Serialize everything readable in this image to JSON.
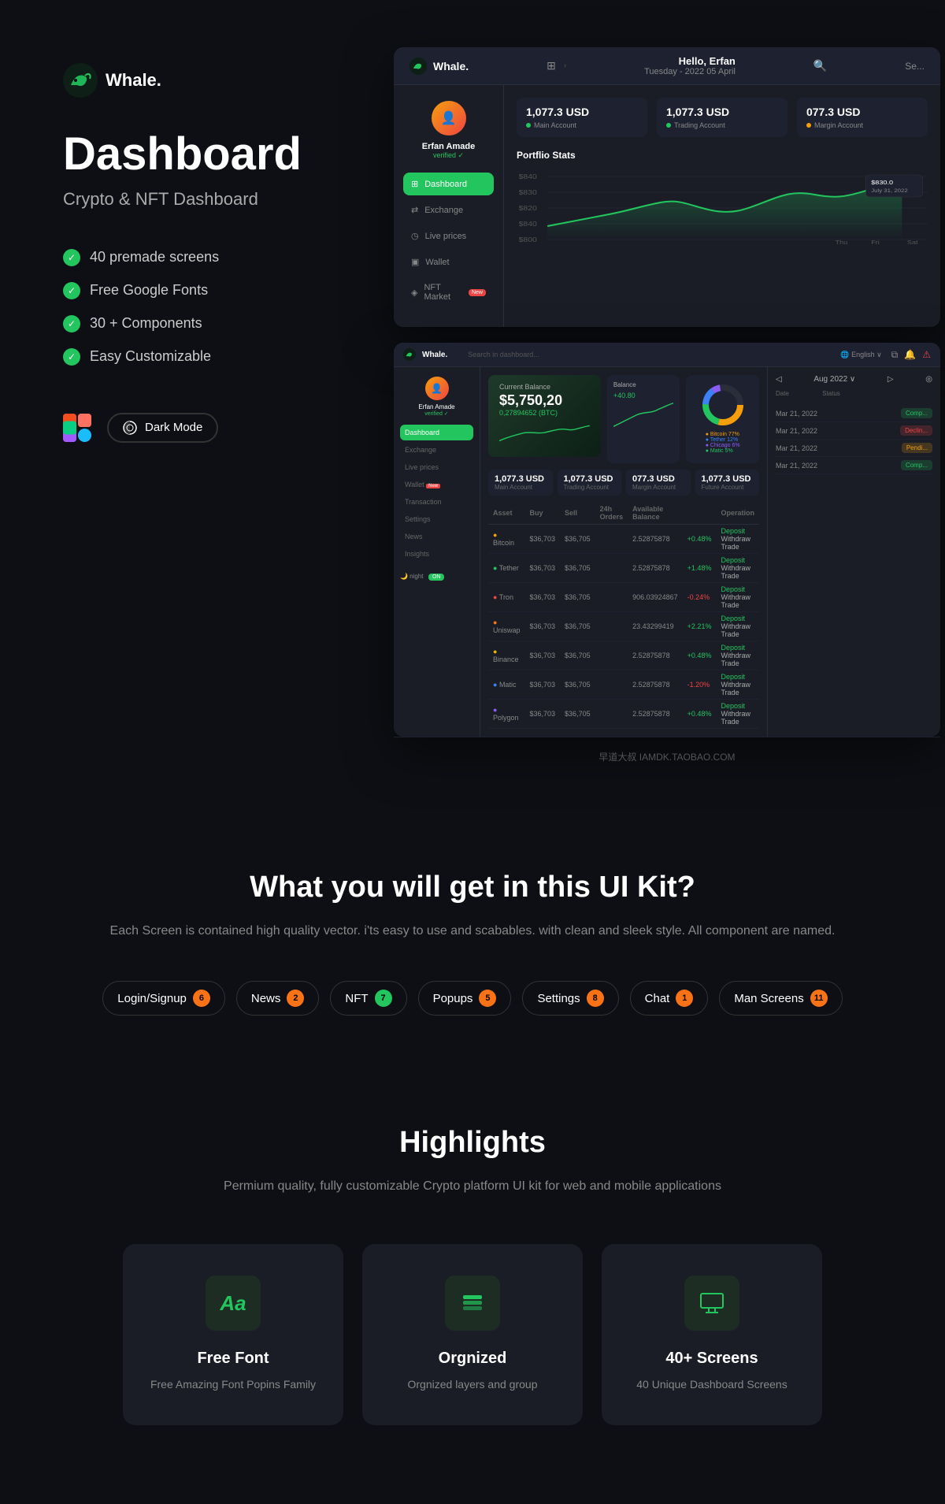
{
  "brand": {
    "name": "Whale.",
    "tagline": "Dashboard"
  },
  "hero": {
    "title": "Dashboard",
    "subtitle": "Crypto & NFT Dashboard",
    "features": [
      "40 premade screens",
      "Free Google Fonts",
      "30 + Components",
      "Easy Customizable"
    ],
    "darkModeLabel": "Dark Mode"
  },
  "dashboard": {
    "greeting": "Hello, Erfan",
    "date": "Tuesday - 2022 05 April",
    "user": "Erfan Amade",
    "verified": "verified",
    "stats": [
      {
        "value": "1,077.3 USD",
        "label": "Main Account",
        "dot": "green"
      },
      {
        "value": "1,077.3 USD",
        "label": "Trading Account",
        "dot": "green"
      },
      {
        "value": "077.3 USD",
        "label": "Margin Account",
        "dot": "orange"
      }
    ],
    "portfolio_title": "Portflio Stats",
    "chart_price": "$830.0",
    "nav": [
      "Dashboard",
      "Exchange",
      "Live prices",
      "Wallet",
      "NFT Market"
    ]
  },
  "dashboard2": {
    "balance_label": "Current Balance",
    "balance_value": "$5,750,20",
    "balance_btc": "0,27894652 (BTC)",
    "stats": [
      {
        "value": "1,077.3 USD",
        "label": "Main Account"
      },
      {
        "value": "1,077.3 USD",
        "label": "Trading Account"
      },
      {
        "value": "077.3 USD",
        "label": "Margin Account"
      },
      {
        "value": "1,077.3 USD",
        "label": "Future Account"
      }
    ],
    "cryptos": [
      {
        "name": "Bitcoin",
        "price1": "$36,703",
        "price2": "$36,705",
        "balance": "2.52875878",
        "change": "+0.48%"
      },
      {
        "name": "Tether",
        "price1": "$36,703",
        "price2": "$36,705",
        "balance": "2.52875878",
        "change": "+1.48%"
      },
      {
        "name": "Tron",
        "price1": "$36,703",
        "price2": "$36,705",
        "balance": "906.03924867",
        "change": "-0.24%"
      },
      {
        "name": "Uniswap",
        "price1": "$36,703",
        "price2": "$36,705",
        "balance": "23.43299419",
        "change": "+2.21%"
      },
      {
        "name": "Binance",
        "price1": "$36,703",
        "price2": "$36,705",
        "balance": "2.52875878",
        "change": "+0.48%"
      },
      {
        "name": "Matic",
        "price1": "$36,703",
        "price2": "$36,705",
        "balance": "2.52875878",
        "change": "-1.20%"
      },
      {
        "name": "Polygon",
        "price1": "$36,703",
        "price2": "$36,705",
        "balance": "2.52875878",
        "change": "+0.48%"
      }
    ],
    "transactions": [
      {
        "date": "Mar 21, 2022",
        "status": "Complete"
      },
      {
        "date": "Mar 21, 2022",
        "status": "Decline"
      },
      {
        "date": "Mar 21, 2022",
        "status": "Pending"
      },
      {
        "date": "Mar 21, 2022",
        "status": "Complete"
      }
    ]
  },
  "watermark": {
    "text": "早道大叔  IAMDK.TAOBAO.COM"
  },
  "what_section": {
    "title": "What you will get in this UI Kit?",
    "subtitle": "Each Screen is contained high quality vector. i'ts easy to use and scabables.\nwith clean and sleek style. All component are named.",
    "tags": [
      {
        "label": "Login/Signup",
        "count": "6",
        "color": "orange"
      },
      {
        "label": "News",
        "count": "2",
        "color": "orange"
      },
      {
        "label": "NFT",
        "count": "7",
        "color": "green"
      },
      {
        "label": "Popups",
        "count": "5",
        "color": "orange"
      },
      {
        "label": "Settings",
        "count": "8",
        "color": "orange"
      },
      {
        "label": "Chat",
        "count": "1",
        "color": "orange"
      },
      {
        "label": "Man Screens",
        "count": "11",
        "color": "orange"
      }
    ]
  },
  "highlights": {
    "title": "Highlights",
    "subtitle": "Permium quality, fully customizable Crypto platform UI kit\nfor web and mobile applications",
    "cards": [
      {
        "icon": "Aa",
        "title": "Free Font",
        "desc": "Free Amazing Font Popins Family",
        "icon_type": "text"
      },
      {
        "icon": "layers",
        "title": "Orgnized",
        "desc": "Orgnized layers and group",
        "icon_type": "svg"
      },
      {
        "icon": "monitor",
        "title": "40+ Screens",
        "desc": "40 Unique Dashboard Screens",
        "icon_type": "svg"
      }
    ]
  }
}
